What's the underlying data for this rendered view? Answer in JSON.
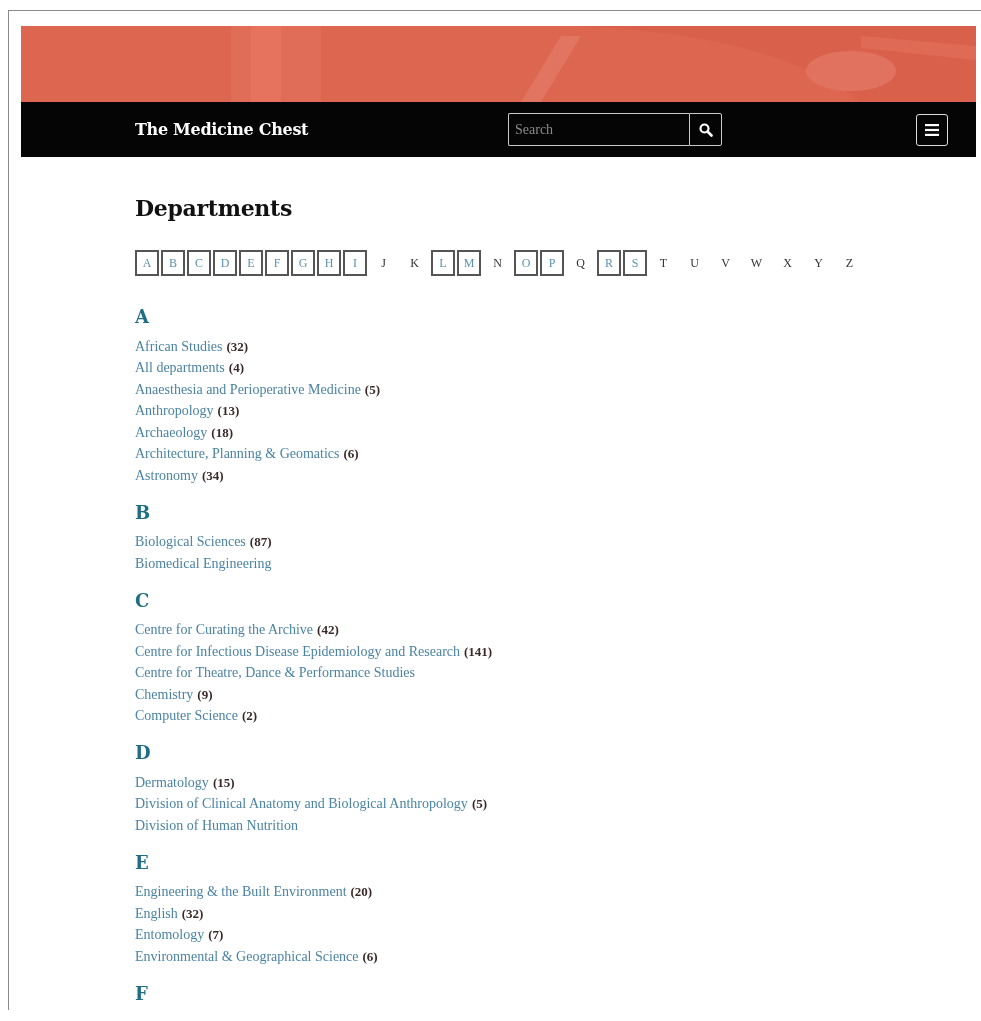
{
  "header": {
    "title": "The Medicine Chest",
    "search": {
      "placeholder": "Search"
    }
  },
  "heading": "Departments",
  "letters": [
    {
      "letter": "A",
      "linked": true
    },
    {
      "letter": "B",
      "linked": true
    },
    {
      "letter": "C",
      "linked": true
    },
    {
      "letter": "D",
      "linked": true
    },
    {
      "letter": "E",
      "linked": true
    },
    {
      "letter": "F",
      "linked": true
    },
    {
      "letter": "G",
      "linked": true
    },
    {
      "letter": "H",
      "linked": true
    },
    {
      "letter": "I",
      "linked": true
    },
    {
      "letter": "J",
      "linked": false
    },
    {
      "letter": "K",
      "linked": false
    },
    {
      "letter": "L",
      "linked": true
    },
    {
      "letter": "M",
      "linked": true
    },
    {
      "letter": "N",
      "linked": false
    },
    {
      "letter": "O",
      "linked": true
    },
    {
      "letter": "P",
      "linked": true
    },
    {
      "letter": "Q",
      "linked": false
    },
    {
      "letter": "R",
      "linked": true
    },
    {
      "letter": "S",
      "linked": true
    },
    {
      "letter": "T",
      "linked": false
    },
    {
      "letter": "U",
      "linked": false
    },
    {
      "letter": "V",
      "linked": false
    },
    {
      "letter": "W",
      "linked": false
    },
    {
      "letter": "X",
      "linked": false
    },
    {
      "letter": "Y",
      "linked": false
    },
    {
      "letter": "Z",
      "linked": false
    }
  ],
  "sections": [
    {
      "letter": "A",
      "items": [
        {
          "name": "African Studies",
          "count": "(32)"
        },
        {
          "name": "All departments",
          "count": "(4)"
        },
        {
          "name": "Anaesthesia and Perioperative Medicine",
          "count": "(5)"
        },
        {
          "name": "Anthropology",
          "count": "(13)"
        },
        {
          "name": "Archaeology",
          "count": "(18)"
        },
        {
          "name": "Architecture, Planning & Geomatics",
          "count": "(6)"
        },
        {
          "name": "Astronomy",
          "count": "(34)"
        }
      ]
    },
    {
      "letter": "B",
      "items": [
        {
          "name": "Biological Sciences",
          "count": "(87)"
        },
        {
          "name": "Biomedical Engineering"
        }
      ]
    },
    {
      "letter": "C",
      "items": [
        {
          "name": "Centre for Curating the Archive",
          "count": "(42)"
        },
        {
          "name": "Centre for Infectious Disease Epidemiology and Research",
          "count": "(141)"
        },
        {
          "name": "Centre for Theatre, Dance & Performance Studies"
        },
        {
          "name": "Chemistry",
          "count": "(9)"
        },
        {
          "name": "Computer Science",
          "count": "(2)"
        }
      ]
    },
    {
      "letter": "D",
      "items": [
        {
          "name": "Dermatology",
          "count": "(15)"
        },
        {
          "name": "Division of Clinical Anatomy and Biological Anthropology",
          "count": "(5)"
        },
        {
          "name": "Division of Human Nutrition"
        }
      ]
    },
    {
      "letter": "E",
      "items": [
        {
          "name": "Engineering & the Built Environment",
          "count": "(20)"
        },
        {
          "name": "English",
          "count": "(32)"
        },
        {
          "name": "Entomology",
          "count": "(7)"
        },
        {
          "name": "Environmental & Geographical Science",
          "count": "(6)"
        }
      ]
    },
    {
      "letter": "F"
    }
  ]
}
